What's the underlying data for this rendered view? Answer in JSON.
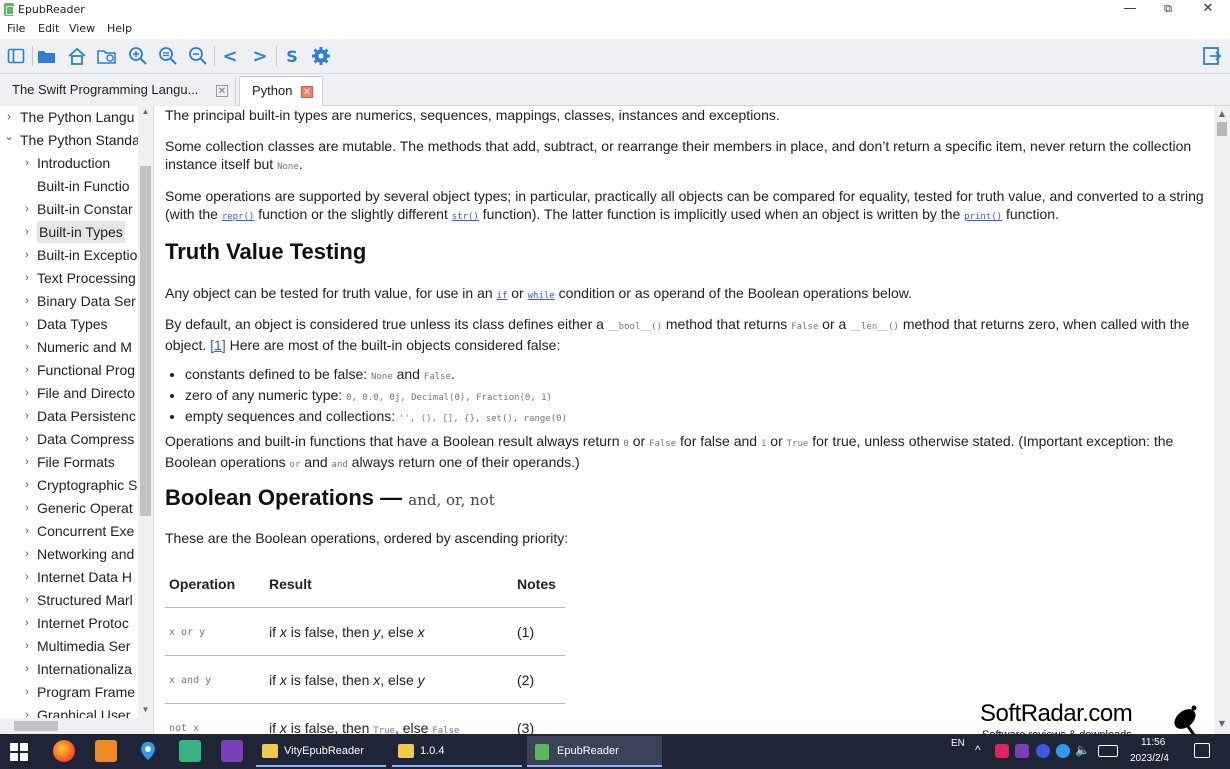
{
  "window": {
    "title": "EpubReader",
    "minimize": "—",
    "maximize": "⧉",
    "close": "✕"
  },
  "menu": [
    "File",
    "Edit",
    "View",
    "Help"
  ],
  "toolbar": {
    "icons": [
      "sidebar-toggle-icon",
      "open-folder-icon",
      "home-icon",
      "library-icon",
      "zoom-in-icon",
      "zoom-reset-icon",
      "zoom-out-icon",
      "previous-icon",
      "next-icon",
      "s-icon",
      "settings-icon",
      "exit-icon"
    ],
    "prev_label": "<",
    "next_label": ">",
    "s_label": "S"
  },
  "tabs": [
    {
      "label": "The Swift Programming Langu...",
      "close": "✕",
      "active": false
    },
    {
      "label": "Python",
      "close": "✕",
      "active": true
    }
  ],
  "sidebar": {
    "items": [
      {
        "label": "The Python Langu",
        "level": 0,
        "expanded": false
      },
      {
        "label": "The Python Standa",
        "level": 0,
        "expanded": true
      },
      {
        "label": "Introduction",
        "level": 1,
        "expanded": false
      },
      {
        "label": "Built-in Functio",
        "level": 1,
        "leaf": true
      },
      {
        "label": "Built-in Constar",
        "level": 1,
        "expanded": false
      },
      {
        "label": "Built-in Types",
        "level": 1,
        "expanded": false,
        "selected": true
      },
      {
        "label": "Built-in Exceptio",
        "level": 1,
        "expanded": false
      },
      {
        "label": "Text Processing",
        "level": 1,
        "expanded": false
      },
      {
        "label": "Binary Data Ser",
        "level": 1,
        "expanded": false
      },
      {
        "label": "Data Types",
        "level": 1,
        "expanded": false
      },
      {
        "label": "Numeric and M",
        "level": 1,
        "expanded": false
      },
      {
        "label": "Functional Prog",
        "level": 1,
        "expanded": false
      },
      {
        "label": "File and Directo",
        "level": 1,
        "expanded": false
      },
      {
        "label": "Data Persistenc",
        "level": 1,
        "expanded": false
      },
      {
        "label": "Data Compress",
        "level": 1,
        "expanded": false
      },
      {
        "label": "File Formats",
        "level": 1,
        "expanded": false
      },
      {
        "label": "Cryptographic S",
        "level": 1,
        "expanded": false
      },
      {
        "label": "Generic Operat",
        "level": 1,
        "expanded": false
      },
      {
        "label": "Concurrent Exe",
        "level": 1,
        "expanded": false
      },
      {
        "label": "Networking and",
        "level": 1,
        "expanded": false
      },
      {
        "label": "Internet Data H",
        "level": 1,
        "expanded": false
      },
      {
        "label": "Structured Marl",
        "level": 1,
        "expanded": false
      },
      {
        "label": "Internet Protoc",
        "level": 1,
        "expanded": false
      },
      {
        "label": "Multimedia Ser",
        "level": 1,
        "expanded": false
      },
      {
        "label": "Internationaliza",
        "level": 1,
        "expanded": false
      },
      {
        "label": "Program Frame",
        "level": 1,
        "expanded": false
      },
      {
        "label": "Graphical User",
        "level": 1,
        "expanded": false
      }
    ]
  },
  "content": {
    "p1": "The principal built-in types are numerics, sequences, mappings, classes, instances and exceptions.",
    "p2a": "Some collection classes are mutable. The methods that add, subtract, or rearrange their members in place, and don’t return a specific item, never return the collection instance itself but ",
    "p2_code": "None",
    "p2b": ".",
    "p3a": "Some operations are supported by several object types; in particular, practically all objects can be compared for equality, tested for truth value, and converted to a string (with the ",
    "p3_repr": "repr()",
    "p3b": " function or the slightly different ",
    "p3_str": "str()",
    "p3c": " function). The latter function is implicitly used when an object is written by the ",
    "p3_print": "print()",
    "p3d": " function.",
    "h_truth": "Truth Value Testing",
    "p4a": "Any object can be tested for truth value, for use in an ",
    "p4_if": "if",
    "p4b": " or ",
    "p4_while": "while",
    "p4c": " condition or as operand of the Boolean operations below.",
    "p5a": "By default, an object is considered true unless its class defines either a ",
    "p5_bool": "__bool__()",
    "p5b": " method that returns ",
    "p5_false": "False",
    "p5c": " or a ",
    "p5_len": "__len__()",
    "p5d": " method that returns zero, when called with the object. ",
    "p5_ref": "[1]",
    "p5e": " Here are most of the built-in objects considered false:",
    "b1a": "constants defined to be false: ",
    "b1_none": "None",
    "b1b": " and ",
    "b1_false": "False",
    "b1c": ".",
    "b2a": "zero of any numeric type: ",
    "b2_code": "0, 0.0, 0j, Decimal(0), Fraction(0, 1)",
    "b3a": "empty sequences and collections: ",
    "b3_code": "'', (), [], {}, set(), range(0)",
    "p6a": "Operations and built-in functions that have a Boolean result always return ",
    "p6_0": "0",
    "p6b": " or ",
    "p6_false": "False",
    "p6c": " for false and ",
    "p6_1": "1",
    "p6d": " or ",
    "p6_true": "True",
    "p6e": " for true, unless otherwise stated. (Important exception: the Boolean operations ",
    "p6_or": "or",
    "p6f": " and ",
    "p6_and": "and",
    "p6g": " always return one of their operands.)",
    "h_bool": "Boolean Operations —",
    "h_bool_code": "and, or, not",
    "p7": "These are the Boolean operations, ordered by ascending priority:",
    "table": {
      "headers": [
        "Operation",
        "Result",
        "Notes"
      ],
      "rows": [
        {
          "op": "x or y",
          "res_a": "if ",
          "res_x": "x",
          "res_b": " is false, then ",
          "res_c": "y",
          "res_d": ", else ",
          "res_e": "x",
          "note": "(1)"
        },
        {
          "op": "x and y",
          "res_a": "if ",
          "res_x": "x",
          "res_b": " is false, then ",
          "res_c": "x",
          "res_d": ", else ",
          "res_e": "y",
          "note": "(2)"
        },
        {
          "op": "not x",
          "res_a": "if ",
          "res_x": "x",
          "res_b": " is false, then ",
          "res_c": "True",
          "res_d": ", else ",
          "res_e": "False",
          "note": "(3)"
        }
      ]
    }
  },
  "watermark": {
    "title": "SoftRadar.com",
    "subtitle": "Software reviews & downloads"
  },
  "taskbar": {
    "apps": [
      {
        "label": "VityEpubReader"
      },
      {
        "label": "1.0.4"
      },
      {
        "label": "EpubReader"
      }
    ],
    "lang": "EN",
    "time": "11:56",
    "date": "2023/2/4"
  },
  "colors": {
    "accent": "#2d7fd1",
    "link": "#3b5bdb",
    "taskbar": "#1d2536"
  }
}
